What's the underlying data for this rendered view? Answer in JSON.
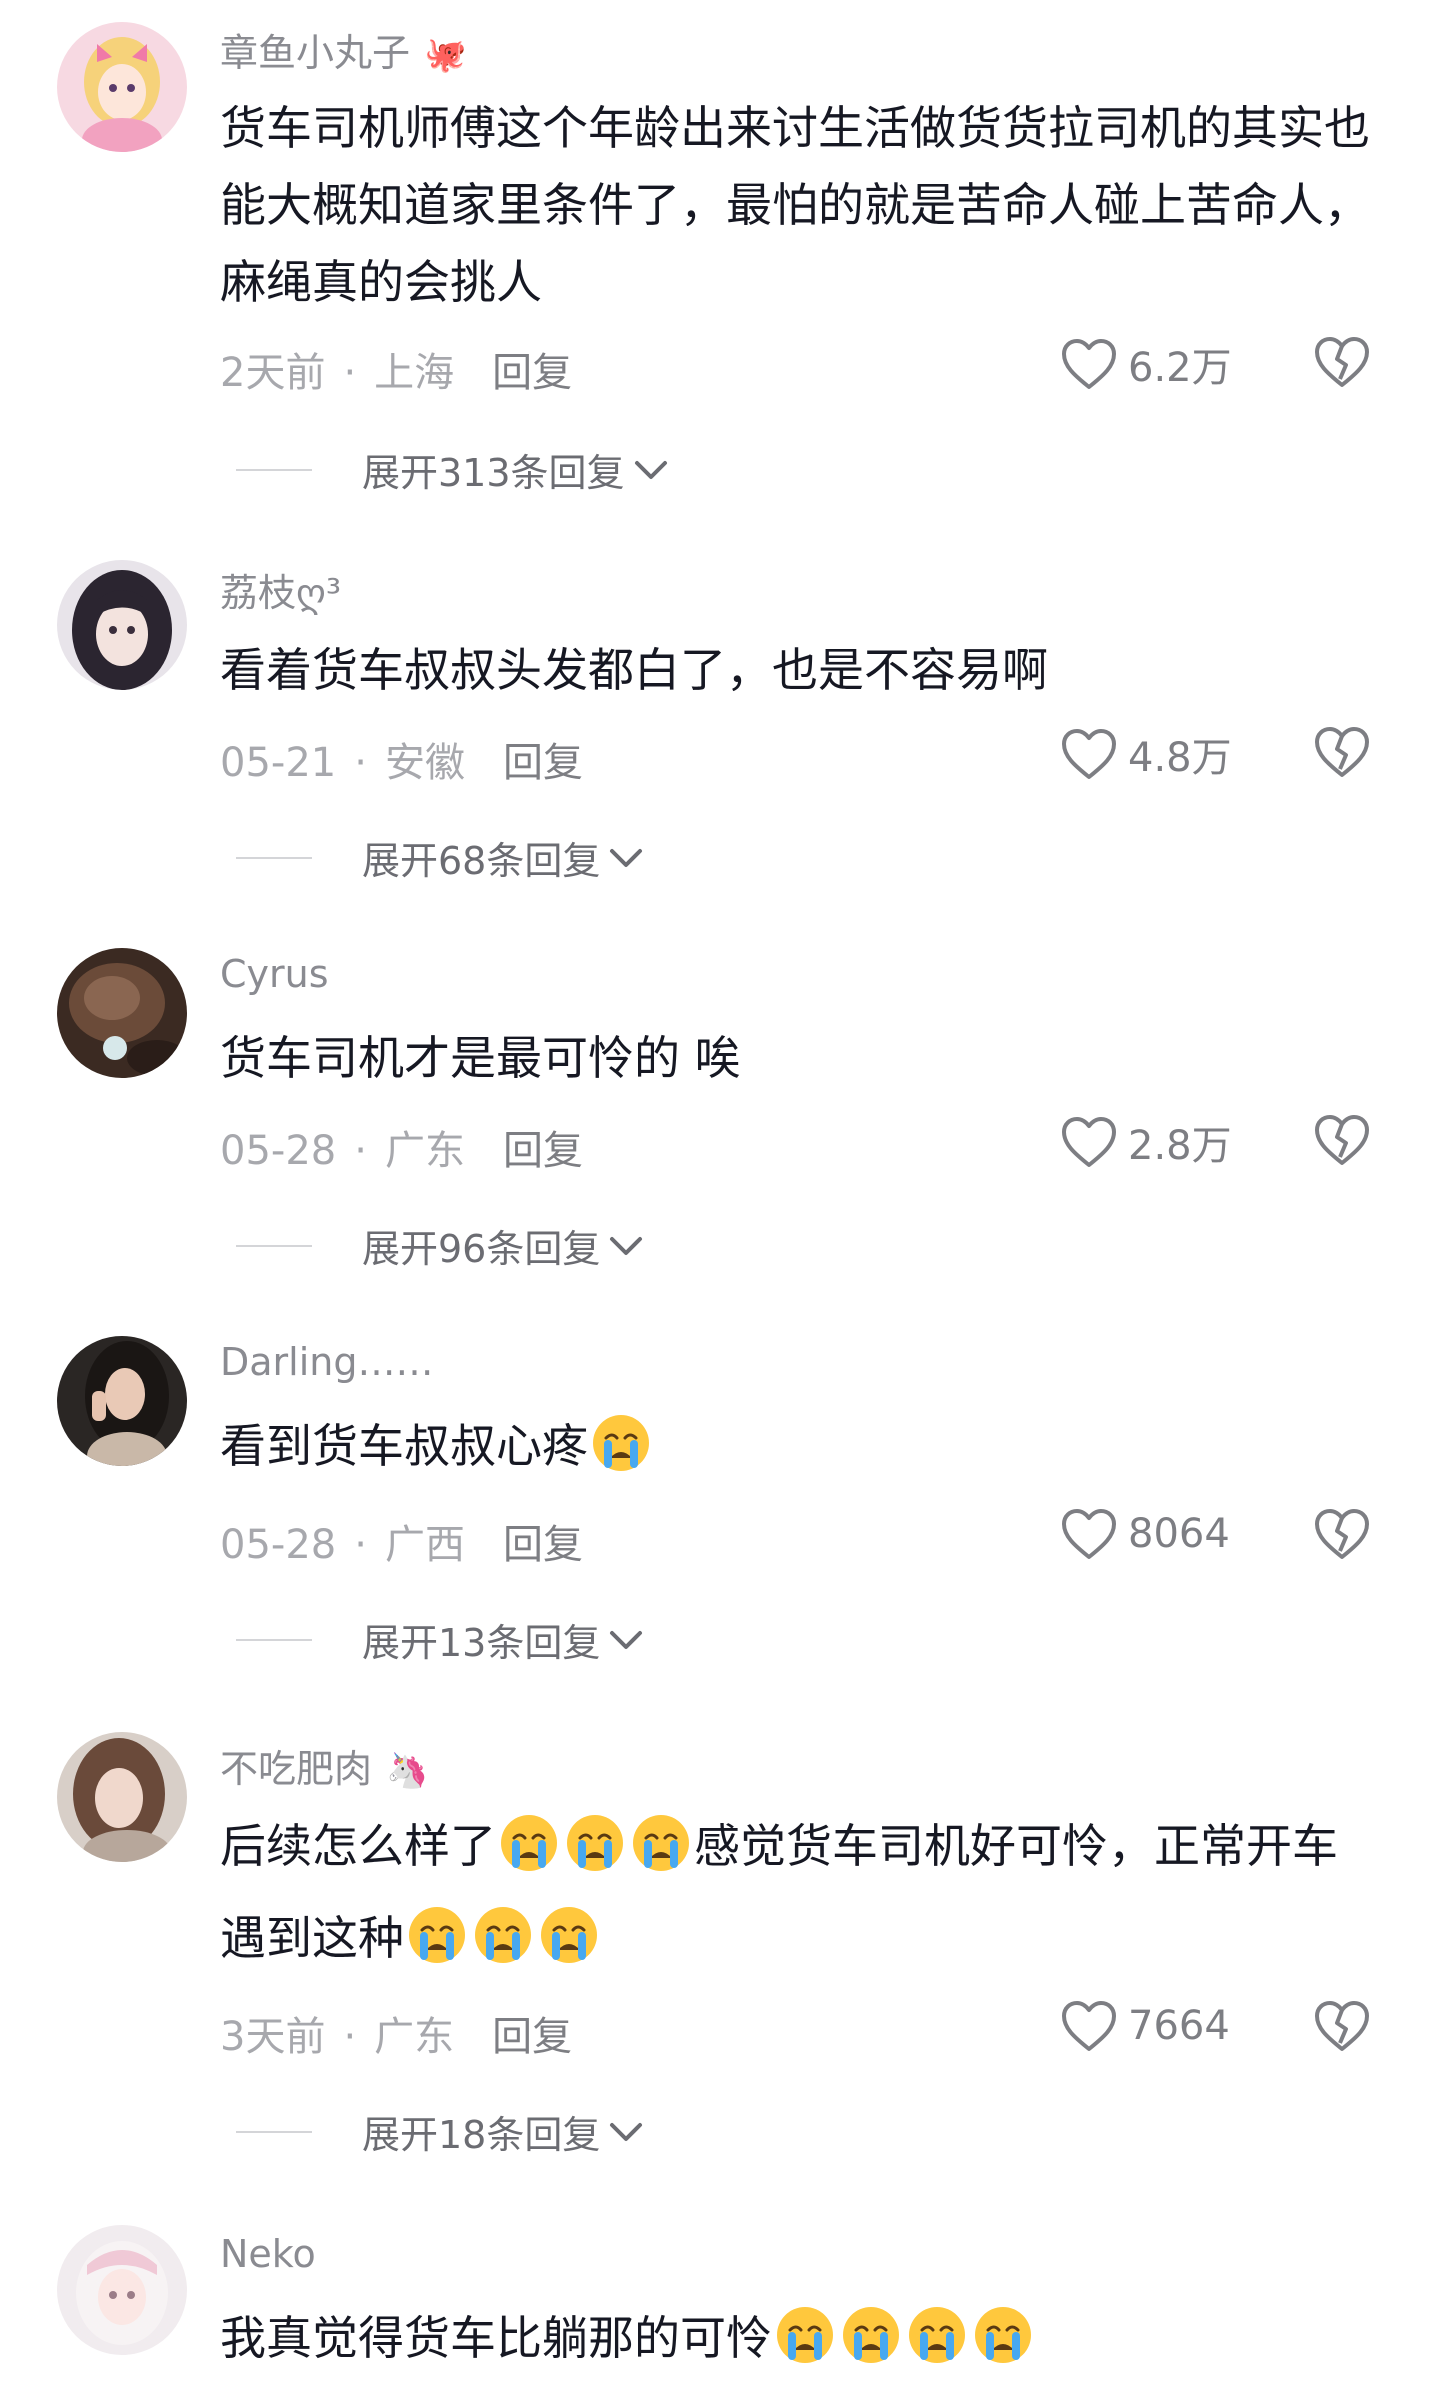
{
  "comments": [
    {
      "username": "章鱼小丸子",
      "username_suffix": "🐙",
      "text": "货车司机师傅这个年龄出来讨生活做货货拉司机的其实也能大概知道家里条件了，最怕的就是苦命人碰上苦命人，麻绳真的会挑人",
      "date": "2天前",
      "location": "上海",
      "reply_label": "回复",
      "likes": "6.2万",
      "expand_label": "展开313条回复"
    },
    {
      "username": "荔枝ღ³",
      "username_suffix": "",
      "text": "看着货车叔叔头发都白了，也是不容易啊",
      "date": "05-21",
      "location": "安徽",
      "reply_label": "回复",
      "likes": "4.8万",
      "expand_label": "展开68条回复"
    },
    {
      "username": "Cyrus",
      "username_suffix": "",
      "text": "货车司机才是最可怜的 唉",
      "date": "05-28",
      "location": "广东",
      "reply_label": "回复",
      "likes": "2.8万",
      "expand_label": "展开96条回复"
    },
    {
      "username": "Darling……",
      "username_suffix": "",
      "text": "看到货车叔叔心疼",
      "date": "05-28",
      "location": "广西",
      "reply_label": "回复",
      "likes": "8064",
      "expand_label": "展开13条回复"
    },
    {
      "username": "不吃肥肉",
      "username_suffix": "🦄",
      "text_a": "后续怎么样了",
      "text_b": "感觉货车司机好可怜，正常开车遇到这种",
      "date": "3天前",
      "location": "广东",
      "reply_label": "回复",
      "likes": "7664",
      "expand_label": "展开18条回复"
    },
    {
      "username": "Neko",
      "username_suffix": "",
      "text": "我真觉得货车比躺那的可怜"
    }
  ],
  "icons": {
    "like": "heart-outline-icon",
    "dislike": "broken-heart-icon",
    "expand": "chevron-down-icon",
    "emoji": "loudly-crying-face-emoji"
  },
  "colors": {
    "text": "#161823",
    "username": "#8a8b91",
    "meta": "#a7a8ad",
    "icon": "#7d7e83",
    "emoji": "#ffc83d"
  }
}
